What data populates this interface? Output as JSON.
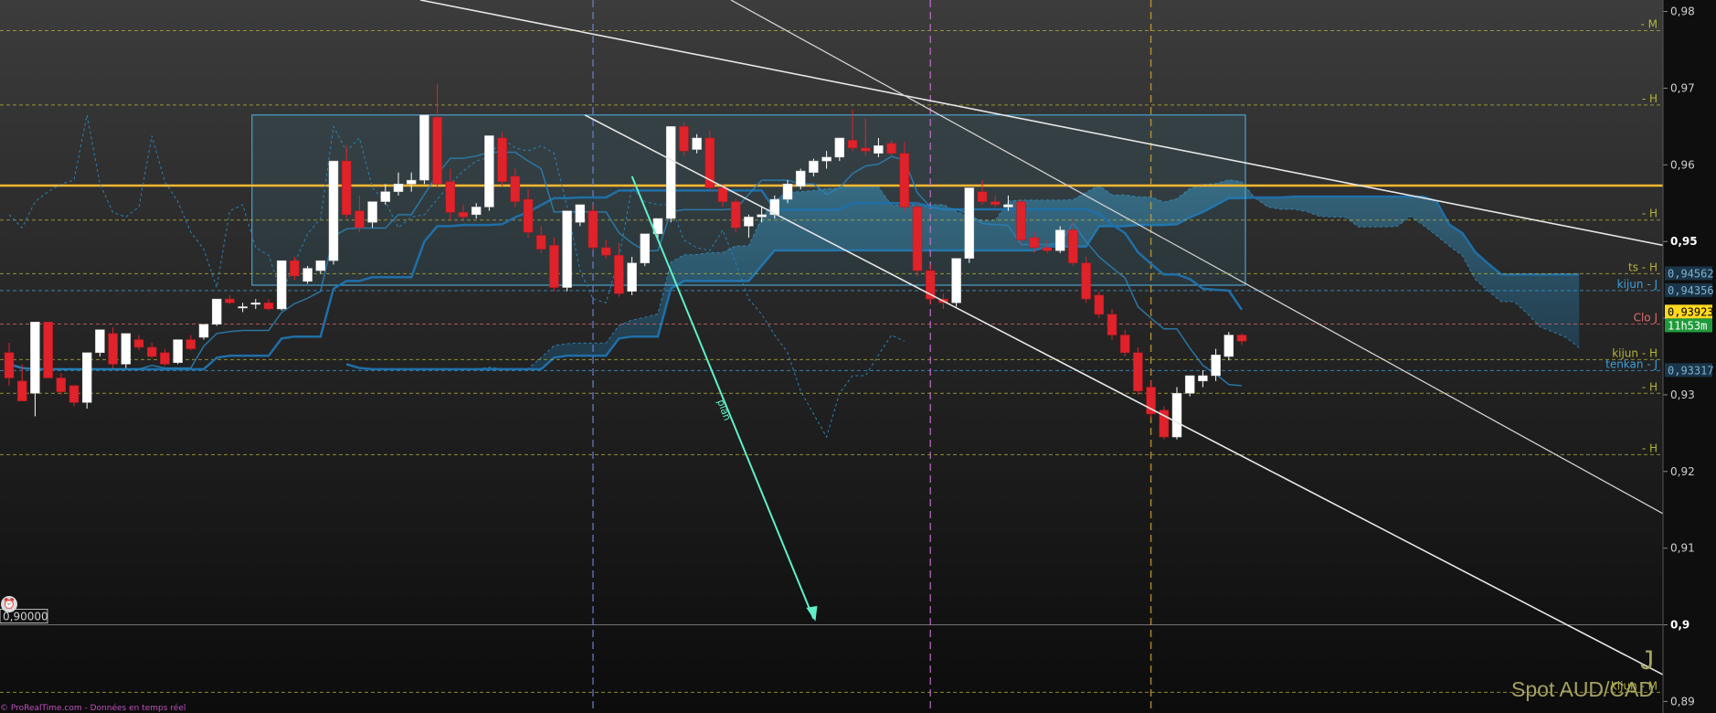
{
  "instrument": "Spot AUD/CAD",
  "period": "J",
  "footer_text": "© ProRealTime.com - Données en temps réel",
  "colors": {
    "background_top": "#3a3a3a",
    "background_bottom": "#0e0e0e",
    "up_candle": "#ffffff",
    "down_candle": "#e0222a",
    "cloud": "#3a8fb7",
    "kijun": "#1f6fa8",
    "resistance_line": "#ffb830",
    "channel_line": "#e6e6e6",
    "projection_arrow": "#5ff0c8",
    "level_line": "#9c9a36",
    "close_line": "#e06a6a",
    "box": "#4fb6e6"
  },
  "chart_data": {
    "type": "candlestick",
    "ylim": [
      0.8885,
      0.9815
    ],
    "y_ticks": [
      "0,98",
      "0,97",
      "0,96",
      "0,95",
      "0,94",
      "0,93",
      "0,92",
      "0,91",
      "0,9",
      "0,89"
    ],
    "y_tick_values": [
      0.98,
      0.97,
      0.96,
      0.95,
      0.94,
      0.93,
      0.92,
      0.91,
      0.9,
      0.89
    ],
    "bold_ticks": [
      "0,95",
      "0,9"
    ],
    "candles": [
      [
        0.9355,
        0.9368,
        0.9322,
        0.9312
      ],
      [
        0.9318,
        0.934,
        0.9292,
        0.9302
      ],
      [
        0.9302,
        0.9395,
        0.9395,
        0.9272
      ],
      [
        0.9395,
        0.9395,
        0.9322,
        0.9322
      ],
      [
        0.9322,
        0.9328,
        0.9304,
        0.93
      ],
      [
        0.9312,
        0.9312,
        0.929,
        0.9285
      ],
      [
        0.929,
        0.9355,
        0.9355,
        0.9282
      ],
      [
        0.9355,
        0.9385,
        0.9385,
        0.935
      ],
      [
        0.938,
        0.9388,
        0.934,
        0.9335
      ],
      [
        0.934,
        0.938,
        0.938,
        0.9335
      ],
      [
        0.9372,
        0.9378,
        0.9362,
        0.9358
      ],
      [
        0.9362,
        0.9368,
        0.935,
        0.9348
      ],
      [
        0.9355,
        0.936,
        0.934,
        0.9338
      ],
      [
        0.9342,
        0.9372,
        0.9372,
        0.934
      ],
      [
        0.9372,
        0.9378,
        0.936,
        0.9358
      ],
      [
        0.9375,
        0.9392,
        0.9392,
        0.9372
      ],
      [
        0.9392,
        0.9425,
        0.9425,
        0.939
      ],
      [
        0.9425,
        0.943,
        0.942,
        0.9418
      ],
      [
        0.9415,
        0.942,
        0.9415,
        0.9408
      ],
      [
        0.9418,
        0.9425,
        0.942,
        0.9412
      ],
      [
        0.942,
        0.9425,
        0.9412,
        0.941
      ],
      [
        0.9412,
        0.9475,
        0.9475,
        0.941
      ],
      [
        0.9475,
        0.948,
        0.9455,
        0.945
      ],
      [
        0.9448,
        0.9468,
        0.9465,
        0.9445
      ],
      [
        0.9462,
        0.9475,
        0.9475,
        0.9458
      ],
      [
        0.9475,
        0.9605,
        0.9605,
        0.947
      ],
      [
        0.9605,
        0.9625,
        0.9535,
        0.953
      ],
      [
        0.954,
        0.956,
        0.9518,
        0.9512
      ],
      [
        0.9525,
        0.9552,
        0.9552,
        0.9518
      ],
      [
        0.9552,
        0.9575,
        0.9565,
        0.9548
      ],
      [
        0.9565,
        0.959,
        0.9575,
        0.956
      ],
      [
        0.9575,
        0.959,
        0.958,
        0.9565
      ],
      [
        0.958,
        0.9665,
        0.9665,
        0.9575
      ],
      [
        0.9662,
        0.9705,
        0.9575,
        0.957
      ],
      [
        0.9578,
        0.9595,
        0.9538,
        0.9528
      ],
      [
        0.9538,
        0.9548,
        0.9532,
        0.9528
      ],
      [
        0.9535,
        0.955,
        0.9545,
        0.953
      ],
      [
        0.9545,
        0.9638,
        0.9638,
        0.954
      ],
      [
        0.9635,
        0.9642,
        0.9578,
        0.9572
      ],
      [
        0.9585,
        0.9595,
        0.9552,
        0.9545
      ],
      [
        0.9555,
        0.9568,
        0.9512,
        0.9505
      ],
      [
        0.9508,
        0.952,
        0.949,
        0.9485
      ],
      [
        0.9495,
        0.9505,
        0.944,
        0.9435
      ],
      [
        0.944,
        0.954,
        0.954,
        0.9435
      ],
      [
        0.9525,
        0.9548,
        0.9548,
        0.952
      ],
      [
        0.954,
        0.9548,
        0.9492,
        0.9488
      ],
      [
        0.9492,
        0.9502,
        0.9482,
        0.9478
      ],
      [
        0.9482,
        0.9498,
        0.9432,
        0.9428
      ],
      [
        0.9435,
        0.948,
        0.9472,
        0.943
      ],
      [
        0.9472,
        0.951,
        0.951,
        0.9468
      ],
      [
        0.951,
        0.953,
        0.953,
        0.9505
      ],
      [
        0.953,
        0.965,
        0.965,
        0.9525
      ],
      [
        0.965,
        0.9655,
        0.9618,
        0.9612
      ],
      [
        0.962,
        0.964,
        0.9635,
        0.9615
      ],
      [
        0.9635,
        0.9645,
        0.957,
        0.9565
      ],
      [
        0.957,
        0.9575,
        0.9552,
        0.9545
      ],
      [
        0.9552,
        0.9555,
        0.9518,
        0.9512
      ],
      [
        0.952,
        0.9535,
        0.9532,
        0.9505
      ],
      [
        0.9532,
        0.9545,
        0.9535,
        0.9525
      ],
      [
        0.9535,
        0.956,
        0.9555,
        0.953
      ],
      [
        0.9555,
        0.958,
        0.9575,
        0.955
      ],
      [
        0.9572,
        0.9595,
        0.9592,
        0.9568
      ],
      [
        0.959,
        0.9608,
        0.9605,
        0.9585
      ],
      [
        0.9605,
        0.9618,
        0.961,
        0.9595
      ],
      [
        0.961,
        0.9635,
        0.9635,
        0.9605
      ],
      [
        0.9632,
        0.9672,
        0.9622,
        0.9618
      ],
      [
        0.9622,
        0.966,
        0.9618,
        0.9612
      ],
      [
        0.9615,
        0.9635,
        0.9625,
        0.961
      ],
      [
        0.9628,
        0.9632,
        0.9615,
        0.961
      ],
      [
        0.9615,
        0.963,
        0.9545,
        0.954
      ],
      [
        0.9545,
        0.955,
        0.9462,
        0.9455
      ],
      [
        0.9462,
        0.947,
        0.9425,
        0.9418
      ],
      [
        0.9425,
        0.9432,
        0.942,
        0.9412
      ],
      [
        0.942,
        0.9478,
        0.9478,
        0.9415
      ],
      [
        0.9478,
        0.957,
        0.957,
        0.9472
      ],
      [
        0.9565,
        0.958,
        0.9552,
        0.9548
      ],
      [
        0.9552,
        0.956,
        0.9548,
        0.9545
      ],
      [
        0.9545,
        0.956,
        0.9548,
        0.954
      ],
      [
        0.9552,
        0.9555,
        0.9502,
        0.9495
      ],
      [
        0.9505,
        0.9512,
        0.9492,
        0.9485
      ],
      [
        0.9492,
        0.9502,
        0.9488,
        0.9485
      ],
      [
        0.9488,
        0.952,
        0.9515,
        0.9485
      ],
      [
        0.9515,
        0.953,
        0.9472,
        0.9468
      ],
      [
        0.9472,
        0.948,
        0.9425,
        0.942
      ],
      [
        0.943,
        0.9435,
        0.9405,
        0.94
      ],
      [
        0.9405,
        0.9412,
        0.9378,
        0.9372
      ],
      [
        0.9378,
        0.9385,
        0.9355,
        0.935
      ],
      [
        0.9355,
        0.9362,
        0.9305,
        0.93
      ],
      [
        0.931,
        0.9318,
        0.9275,
        0.927
      ],
      [
        0.928,
        0.9285,
        0.9245,
        0.9242
      ],
      [
        0.9245,
        0.931,
        0.9302,
        0.9242
      ],
      [
        0.9302,
        0.9325,
        0.9325,
        0.9298
      ],
      [
        0.9318,
        0.9332,
        0.9325,
        0.931
      ],
      [
        0.9325,
        0.936,
        0.9352,
        0.9318
      ],
      [
        0.935,
        0.9382,
        0.9378,
        0.9345
      ],
      [
        0.9378,
        0.938,
        0.937,
        0.9365
      ]
    ],
    "levels": [
      {
        "label": "- M",
        "value": 0.9775,
        "color": "#b5b33a"
      },
      {
        "label": "- H",
        "value": 0.9678,
        "color": "#b5b33a"
      },
      {
        "label": "- H",
        "value": 0.9528,
        "color": "#b5b33a"
      },
      {
        "label": "ts - H",
        "value": 0.9458,
        "color": "#b5b33a"
      },
      {
        "label": "kijun - J",
        "value": 0.9436,
        "color": "#3aa0e0"
      },
      {
        "label": "Clo J",
        "value": 0.93923,
        "color": "#e06a6a"
      },
      {
        "label": "kijun - H",
        "value": 0.9346,
        "color": "#b5b33a"
      },
      {
        "label": "tenkan - J",
        "value": 0.93317,
        "color": "#3aa0e0"
      },
      {
        "label": "- H",
        "value": 0.9302,
        "color": "#b5b33a"
      },
      {
        "label": "- H",
        "value": 0.9222,
        "color": "#b5b33a"
      },
      {
        "label": "kijun - M",
        "value": 0.8912,
        "color": "#b5b33a"
      }
    ],
    "price_labels": [
      {
        "text": "0,94562",
        "value": 0.9458,
        "bg": "#1a3548",
        "fg": "#7fb0d0"
      },
      {
        "text": "0,94356",
        "value": 0.9436,
        "bg": "#1a3548",
        "fg": "#7fb0d0"
      },
      {
        "text": "0,93923",
        "value": 0.9408,
        "bg": "#ffd820",
        "fg": "#000000"
      },
      {
        "text": "11h53m",
        "value": 0.939,
        "bg": "#1f9a3a",
        "fg": "#ffffff"
      },
      {
        "text": "0,93317",
        "value": 0.93317,
        "bg": "#1a3548",
        "fg": "#7fb0d0"
      }
    ],
    "resistance": 0.9573,
    "marker_label": "0,90000",
    "marker_value": 0.9,
    "projection_label": "plan",
    "vlines": [
      {
        "candle": 45,
        "color": "#6a7fd0"
      },
      {
        "candle": 71,
        "color": "#c66ad0"
      },
      {
        "candle": 88,
        "color": "#d0a030"
      }
    ]
  }
}
